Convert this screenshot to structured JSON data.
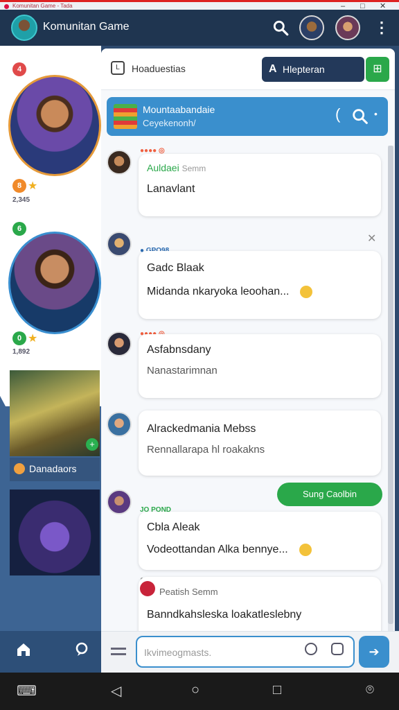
{
  "window": {
    "title": "Komunitan Game - Tada"
  },
  "header": {
    "title": "Komunitan Game",
    "icons": [
      "search-icon",
      "more-vertical-icon"
    ]
  },
  "rail": {
    "badges": [
      "4",
      "8",
      "6",
      "0"
    ],
    "counts": [
      "2,345",
      "1,892"
    ],
    "tile_label": "Danadaors",
    "tile_badge": "+"
  },
  "tabbar": {
    "tab_label": "Hoaduestias",
    "tab_icon_text": "L",
    "primary_button": "Hlepteran",
    "primary_icon": "A"
  },
  "banner": {
    "title": "Mountaabandaie",
    "subtitle": "Ceyekenonh/"
  },
  "messages": [
    {
      "rank": "●●●● ◎",
      "name": "Auldaei",
      "name_suffix": "Semm",
      "body": "Lanavlant",
      "closable": true
    },
    {
      "rank": "● GPO98",
      "name": "Gadc Blaak",
      "body": "Midanda nkaryoka leoohan...",
      "emoji": true,
      "closable": true
    },
    {
      "rank": "●●●● ◎",
      "name": "Asfabnsdany",
      "sub": "Nanastarimnan",
      "closable": true
    },
    {
      "rank": "●●●● ◎",
      "name": "Alrackedmania Mebss",
      "sub": "Rennallarapa hl roakakns",
      "closable": false
    },
    {
      "rank": "JO POND",
      "name": "Cbla Aleak",
      "body": "Vodeottandan Alka bennye...",
      "emoji": true,
      "closable": false
    },
    {
      "rank": "●●●●",
      "name": "Peatish",
      "name_suffix": "Semm",
      "body": "Banndkahsleska loakatleslebny",
      "closable": false
    }
  ],
  "chip": {
    "label": "Sung Caolbin"
  },
  "composer": {
    "placeholder": "Ikvimeogmasts."
  },
  "colors": {
    "header": "#1f3550",
    "accent": "#3a8fcd",
    "green": "#2aa84a",
    "orange": "#e59a3a"
  }
}
